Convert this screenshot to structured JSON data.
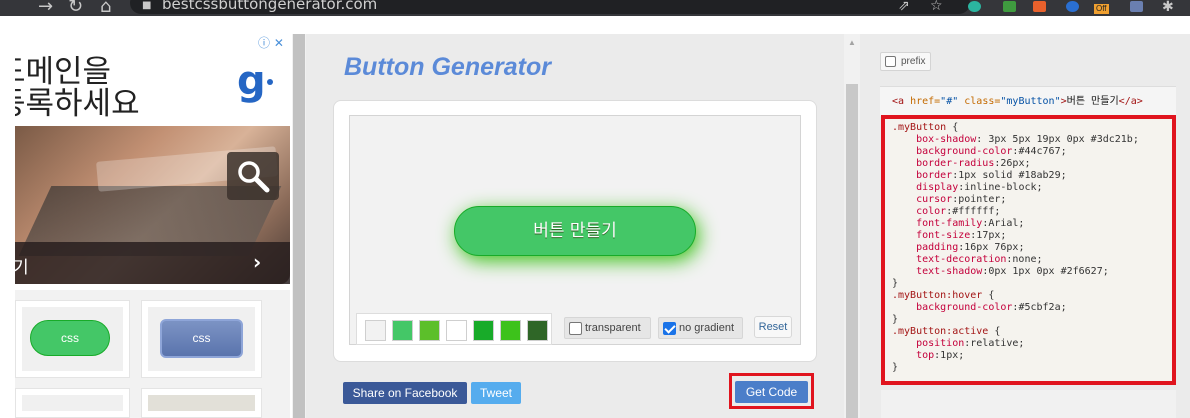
{
  "browser": {
    "url": "bestcssbuttongenerator.com",
    "ext_badge": "Off"
  },
  "ad": {
    "line1": "도메인을",
    "line2": "등록하세요",
    "logo": "g",
    "bar_text": "기"
  },
  "gallery": {
    "items": [
      "css",
      "css"
    ]
  },
  "generator": {
    "title": "Button Generator",
    "preview_button": "버튼 만들기",
    "swatches": [
      "#f2f2f2",
      "#44c767",
      "#5cbf2a",
      "#ffffff",
      "#18ab29",
      "#3dc21b",
      "#2f6627"
    ],
    "transparent_label": "transparent",
    "no_gradient_label": "no gradient",
    "reset_label": "Reset",
    "facebook_label": "Share on Facebook",
    "tweet_label": "Tweet",
    "get_code_label": "Get Code"
  },
  "code_panel": {
    "prefix_label": "prefix",
    "html": {
      "open": "<a",
      "href_attr": " href=",
      "href_val": "\"#\"",
      "class_attr": " class=",
      "class_val": "\"myButton\"",
      "close_open": ">",
      "text": "버튼 만들기",
      "end_tag": "</a>"
    },
    "css_lines": [
      [
        [
          "sel",
          ".myButton "
        ],
        [
          "val",
          "{"
        ]
      ],
      [
        [
          "prop",
          "\tbox-shadow"
        ],
        [
          "val",
          ": 3px 5px 19px 0px #3dc21b;"
        ]
      ],
      [
        [
          "prop",
          "\tbackground-color"
        ],
        [
          "val",
          ":#44c767;"
        ]
      ],
      [
        [
          "prop",
          "\tborder-radius"
        ],
        [
          "val",
          ":26px;"
        ]
      ],
      [
        [
          "prop",
          "\tborder"
        ],
        [
          "val",
          ":1px solid #18ab29;"
        ]
      ],
      [
        [
          "prop",
          "\tdisplay"
        ],
        [
          "val",
          ":inline-block;"
        ]
      ],
      [
        [
          "prop",
          "\tcursor"
        ],
        [
          "val",
          ":pointer;"
        ]
      ],
      [
        [
          "prop",
          "\tcolor"
        ],
        [
          "val",
          ":#ffffff;"
        ]
      ],
      [
        [
          "prop",
          "\tfont-family"
        ],
        [
          "val",
          ":Arial;"
        ]
      ],
      [
        [
          "prop",
          "\tfont-size"
        ],
        [
          "val",
          ":17px;"
        ]
      ],
      [
        [
          "prop",
          "\tpadding"
        ],
        [
          "val",
          ":16px 76px;"
        ]
      ],
      [
        [
          "prop",
          "\ttext-decoration"
        ],
        [
          "val",
          ":none;"
        ]
      ],
      [
        [
          "prop",
          "\ttext-shadow"
        ],
        [
          "val",
          ":0px 1px 0px #2f6627;"
        ]
      ],
      [
        [
          "val",
          "}"
        ]
      ],
      [
        [
          "sel",
          ".myButton:hover "
        ],
        [
          "val",
          "{"
        ]
      ],
      [
        [
          "prop",
          "\tbackground-color"
        ],
        [
          "val",
          ":#5cbf2a;"
        ]
      ],
      [
        [
          "val",
          "}"
        ]
      ],
      [
        [
          "sel",
          ".myButton:active "
        ],
        [
          "val",
          "{"
        ]
      ],
      [
        [
          "prop",
          "\tposition"
        ],
        [
          "val",
          ":relative;"
        ]
      ],
      [
        [
          "prop",
          "\ttop"
        ],
        [
          "val",
          ":1px;"
        ]
      ],
      [
        [
          "val",
          "}"
        ]
      ]
    ]
  }
}
